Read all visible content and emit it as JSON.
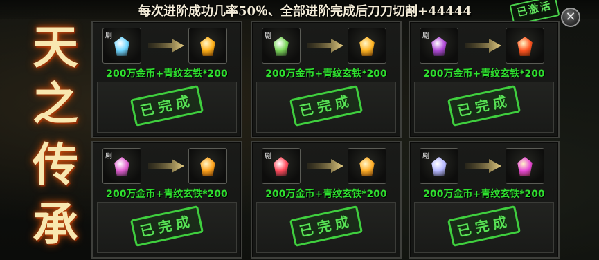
{
  "header": {
    "banner": "每次进阶成功几率50％、全部进阶完成后刀刀切割+44444",
    "activated_badge": "已激活",
    "close_symbol": "✕"
  },
  "title": {
    "chars": [
      "天",
      "之",
      "传",
      "承"
    ]
  },
  "panels": [
    {
      "from_tag": "剧",
      "from_gem_color": "#6fd6ff",
      "to_gem_color": "#ffb018",
      "cost": "200万金币+青纹玄铁*200",
      "status": "已完成"
    },
    {
      "from_tag": "剧",
      "from_gem_color": "#7bd65a",
      "to_gem_color": "#ffb423",
      "cost": "200万金币+青纹玄铁*200",
      "status": "已完成"
    },
    {
      "from_tag": "剧",
      "from_gem_color": "#b04ad8",
      "to_gem_color": "#ff5522",
      "cost": "200万金币+青纹玄铁*200",
      "status": "已完成"
    },
    {
      "from_tag": "剧",
      "from_gem_color": "#e05fd0",
      "to_gem_color": "#ffa31c",
      "cost": "200万金币+青纹玄铁*200",
      "status": "已完成"
    },
    {
      "from_tag": "剧",
      "from_gem_color": "#ff4a5c",
      "to_gem_color": "#ffae28",
      "cost": "200万金币+青纹玄铁*200",
      "status": "已完成"
    },
    {
      "from_tag": "剧",
      "from_gem_color": "#b6b8ff",
      "to_gem_color": "#e84ad8",
      "cost": "200万金币+青纹玄铁*200",
      "status": "已完成"
    }
  ]
}
